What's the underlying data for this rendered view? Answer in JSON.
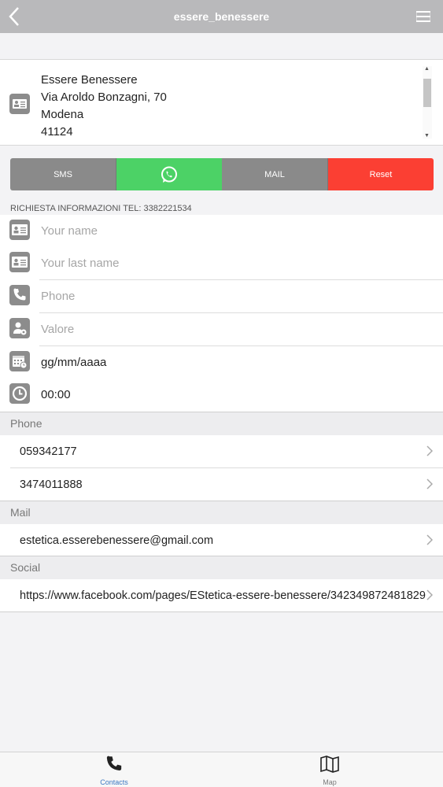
{
  "header": {
    "title": "essere_benessere"
  },
  "address": {
    "line1": "Essere Benessere",
    "line2": "Via Aroldo Bonzagni, 70",
    "line3": "Modena",
    "line4": "41124"
  },
  "actions": {
    "sms": "SMS",
    "mail": "MAIL",
    "reset": "Reset",
    "colors": {
      "whatsapp": "#4cd266",
      "reset": "#fb3f33",
      "neutral": "#8a8a8a"
    }
  },
  "request_label": "RICHIESTA INFORMAZIONI TEL: 3382221534",
  "form": {
    "name_placeholder": "Your name",
    "last_name_placeholder": "Your last name",
    "phone_placeholder": "Phone",
    "value_placeholder": "Valore",
    "date_value": "gg/mm/aaaa",
    "time_value": "00:00"
  },
  "sections": {
    "phone": {
      "title": "Phone",
      "items": [
        "059342177",
        "3474011888"
      ]
    },
    "mail": {
      "title": "Mail",
      "items": [
        "estetica.esserebenessere@gmail.com"
      ]
    },
    "social": {
      "title": "Social",
      "items": [
        "https://www.facebook.com/pages/EStetica-essere-benessere/342349872481829"
      ]
    }
  },
  "tabbar": {
    "contacts": "Contacts",
    "map": "Map",
    "active_color": "#3a78c2"
  }
}
